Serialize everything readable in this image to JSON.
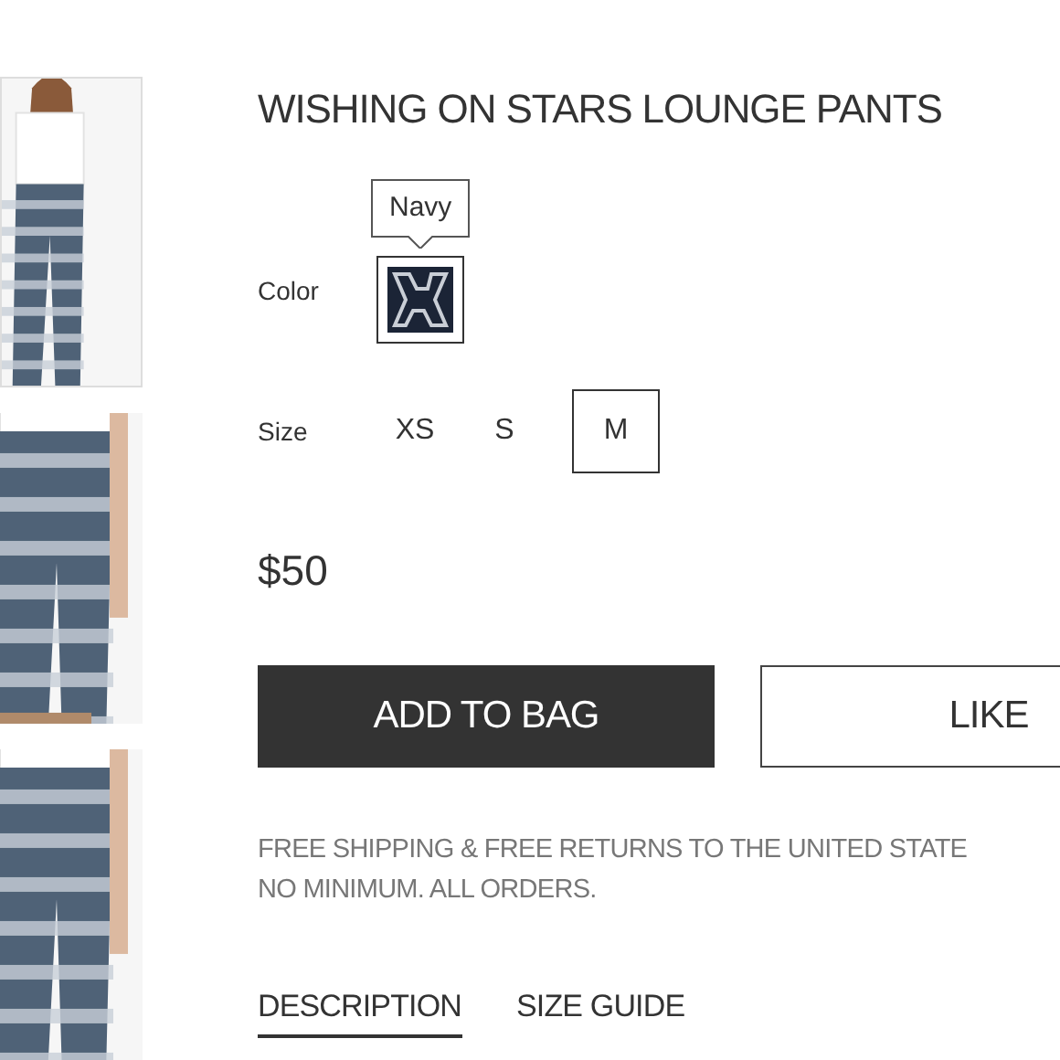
{
  "gallery": [
    {
      "kind": "picture"
    },
    {
      "kind": "picture"
    },
    {
      "kind": "picture"
    }
  ],
  "product": {
    "title": "WISHING ON STARS LOUNGE PANTS",
    "price": "$50"
  },
  "color": {
    "label": "Color",
    "tooltip": "Navy",
    "swatches": [
      {
        "selected": true
      }
    ]
  },
  "size": {
    "label": "Size",
    "options": [
      {
        "label": "XS",
        "selected": false
      },
      {
        "label": "S",
        "selected": false
      },
      {
        "label": "M",
        "selected": true
      }
    ]
  },
  "buttons": [
    {
      "label": "ADD TO BAG",
      "kind": "primary"
    },
    {
      "label": "LIKE",
      "kind": "secondary"
    }
  ],
  "shipping": [
    "FREE SHIPPING & FREE RETURNS TO THE UNITED STATE",
    "NO MINIMUM. ALL ORDERS."
  ],
  "tabs": [
    {
      "label": "DESCRIPTION",
      "selected": true
    },
    {
      "label": "SIZE GUIDE",
      "selected": false
    }
  ]
}
